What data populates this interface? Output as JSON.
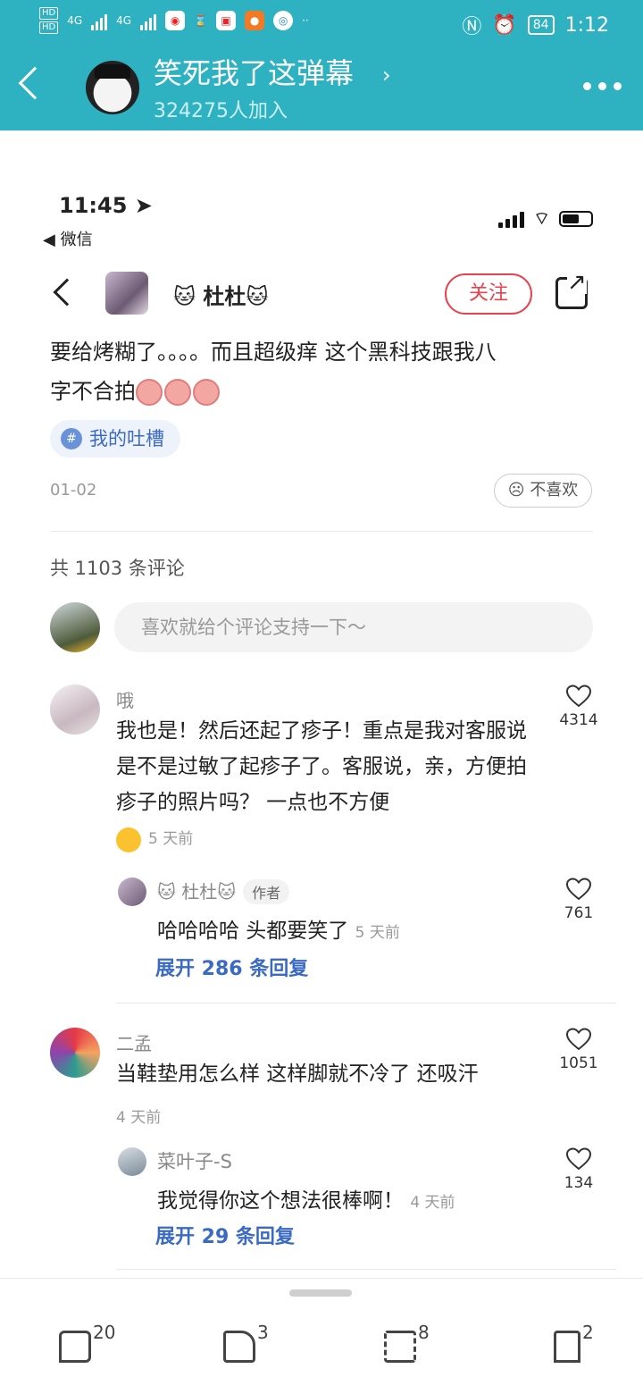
{
  "status_bar": {
    "signal_a": "4G",
    "signal_b": "4G",
    "battery": "84",
    "time": "1:12"
  },
  "group": {
    "title": "笑死我了这弹幕",
    "members": "324275人加入"
  },
  "ios": {
    "time": "11:45",
    "back_label": "◀ 微信"
  },
  "post": {
    "author": "🐱 杜杜🐱",
    "follow_label": "关注",
    "body_line1": "要给烤糊了。。。。而且超级痒 这个黑科技跟我八",
    "body_line2": "字不合拍",
    "topic": "我的吐槽",
    "date": "01-02",
    "dislike_label": "不喜欢"
  },
  "comments_header": {
    "count_label": "共 1103 条评论",
    "input_placeholder": "喜欢就给个评论支持一下～"
  },
  "comments": [
    {
      "name": "哦",
      "text": "我也是！然后还起了疹子！重点是我对客服说 是不是过敏了起疹子了。客服说，亲，方便拍疹子的照片吗？ 一点也不方便",
      "time": "5 天前",
      "likes": "4314",
      "reply": {
        "name": "🐱 杜杜🐱",
        "tag": "作者",
        "text": "哈哈哈哈 头都要笑了",
        "time": "5 天前",
        "likes": "761"
      },
      "expand": "展开 286 条回复"
    },
    {
      "name": "二孟",
      "text": "当鞋垫用怎么样 这样脚就不冷了 还吸汗",
      "time": "4 天前",
      "likes": "1051",
      "reply": {
        "name": "菜叶子-S",
        "text": "我觉得你这个想法很棒啊！",
        "time": "4 天前",
        "likes": "134"
      },
      "expand": "展开 29 条回复"
    }
  ],
  "toolbar": {
    "comment_count": "20",
    "like_count": "3",
    "repost_count": "8",
    "save_count": "2"
  },
  "colors": {
    "header": "#2eb1c1",
    "follow": "#e8424f",
    "link": "#3b6ac2"
  }
}
